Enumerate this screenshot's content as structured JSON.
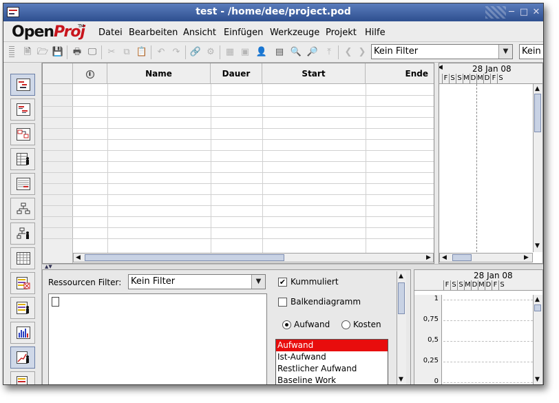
{
  "window": {
    "title": "test - /home/dee/project.pod"
  },
  "logo": {
    "open": "Open",
    "proj": "Proj",
    "tm": "TM"
  },
  "menu": [
    "Datei",
    "Bearbeiten",
    "Ansicht",
    "Einfügen",
    "Werkzeuge",
    "Projekt",
    "Hilfe"
  ],
  "toolbar": {
    "filter_value": "Kein Filter",
    "second_value": "Kein"
  },
  "table": {
    "columns": [
      "",
      "",
      "Name",
      "Dauer",
      "Start",
      "Ende"
    ]
  },
  "gantt": {
    "date": "28 Jan 08",
    "days": [
      "F",
      "S",
      "S",
      "M",
      "D",
      "M",
      "D",
      "F",
      "S"
    ]
  },
  "resources": {
    "filter_label": "Ressourcen Filter:",
    "filter_value": "Kein Filter",
    "kummuliert": "Kummuliert",
    "balkendiagramm": "Balkendiagramm",
    "aufwand_radio": "Aufwand",
    "kosten_radio": "Kosten",
    "types": [
      "Aufwand",
      "Ist-Aufwand",
      "Restlicher Aufwand",
      "Baseline Work"
    ]
  },
  "histogram": {
    "date": "28 Jan 08",
    "days": [
      "F",
      "S",
      "S",
      "M",
      "D",
      "M",
      "D",
      "F",
      "S"
    ],
    "yticks": [
      "1",
      "0,75",
      "0,5",
      "0,25",
      "0"
    ]
  },
  "colors": {
    "title_bar": "#2e4f8f",
    "logo_red": "#c8141c",
    "selected_item": "#e80d0d"
  }
}
